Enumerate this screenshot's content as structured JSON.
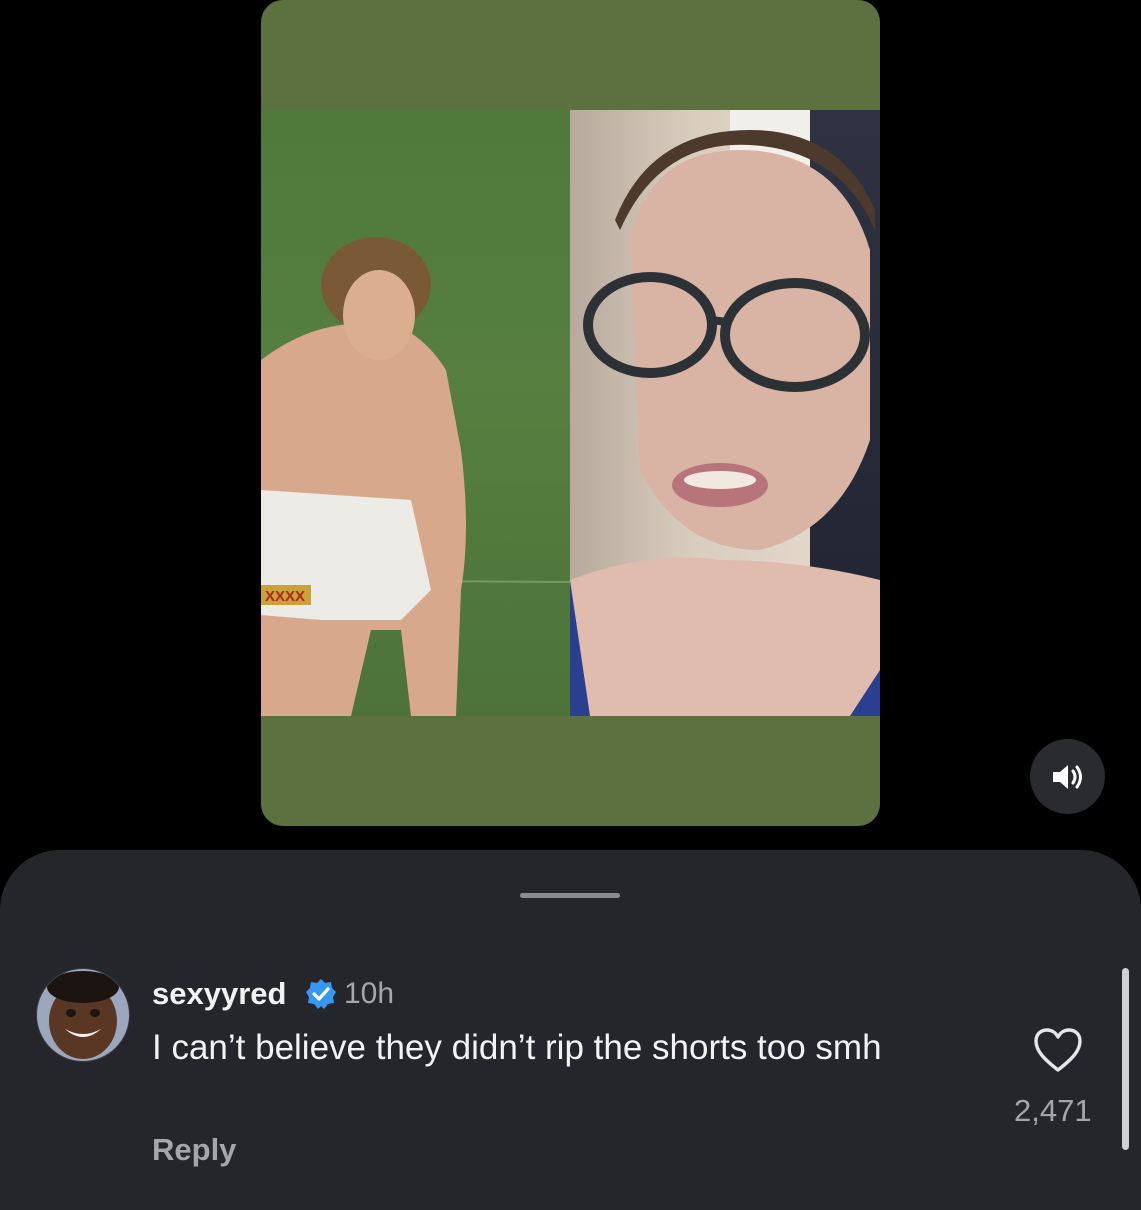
{
  "video": {
    "background_color": "#5d703f",
    "left_panel_content": "rugby-player-photo",
    "right_panel_content": "woman-with-glasses-video",
    "left_panel_shorts_text": "XXXX",
    "sound_icon": "speaker-on-icon"
  },
  "comments_sheet": {
    "comment": {
      "avatar_icon": "user-avatar",
      "username": "sexyyred",
      "verified": true,
      "timestamp": "10h",
      "text": "I can’t believe they didn’t rip the shorts too smh",
      "reply_label": "Reply",
      "like_icon": "heart-outline-icon",
      "like_count": "2,471"
    }
  },
  "colors": {
    "accent_verified": "#3897f0",
    "sheet_background": "#25262b"
  }
}
